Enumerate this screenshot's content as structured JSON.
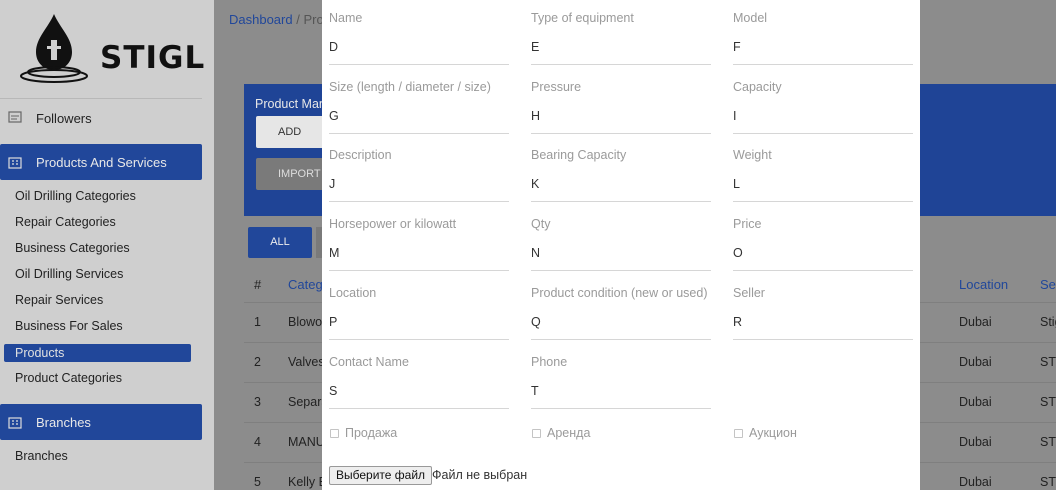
{
  "app": {
    "logo_text": "STIGL"
  },
  "sidebar": {
    "followers_label": "Followers",
    "products_services_label": "Products And Services",
    "sub_items": [
      "Oil Drilling Categories",
      "Repair Categories",
      "Business Categories",
      "Oil Drilling Services",
      "Repair Services",
      "Business For Sales",
      "Products",
      "Product Categories"
    ],
    "branches_header": "Branches",
    "branches_item": "Branches"
  },
  "breadcrumb": {
    "root": "Dashboard",
    "sep": "/",
    "current": "Pro"
  },
  "panel": {
    "title": "Product Man",
    "add_label": "ADD NEW",
    "import_label": "IMPORT"
  },
  "filters": {
    "all_label": "ALL"
  },
  "table": {
    "headers": {
      "num": "#",
      "category": "Categ",
      "location": "Location",
      "seller": "Sel"
    },
    "rows": [
      {
        "num": "1",
        "category": "Blowo",
        "location": "Dubai",
        "seller": "Stig"
      },
      {
        "num": "2",
        "category": "Valves",
        "location": "Dubai",
        "seller": "STI"
      },
      {
        "num": "3",
        "category": "Separa",
        "location": "Dubai",
        "seller": "STI"
      },
      {
        "num": "4",
        "category": "MANU",
        "location": "Dubai",
        "seller": "STI"
      },
      {
        "num": "5",
        "category": "Kelly E",
        "location": "Dubai",
        "seller": "STI"
      }
    ]
  },
  "modal": {
    "fields": [
      {
        "label": "Name",
        "value": "D"
      },
      {
        "label": "Type of equipment",
        "value": "E"
      },
      {
        "label": "Model",
        "value": "F"
      },
      {
        "label": "Size (length / diameter / size)",
        "value": "G"
      },
      {
        "label": "Pressure",
        "value": "H"
      },
      {
        "label": "Capacity",
        "value": "I"
      },
      {
        "label": "Description",
        "value": "J"
      },
      {
        "label": "Bearing Capacity",
        "value": "K"
      },
      {
        "label": "Weight",
        "value": "L"
      },
      {
        "label": "Horsepower or kilowatt",
        "value": "M"
      },
      {
        "label": "Qty",
        "value": "N"
      },
      {
        "label": "Price",
        "value": "O"
      },
      {
        "label": "Location",
        "value": "P"
      },
      {
        "label": "Product condition (new or used)",
        "value": "Q"
      },
      {
        "label": "Seller",
        "value": "R"
      },
      {
        "label": "Contact Name",
        "value": "S"
      },
      {
        "label": "Phone",
        "value": "T"
      }
    ],
    "checkboxes": [
      {
        "label": "Продажа",
        "checked": false
      },
      {
        "label": "Аренда",
        "checked": false
      },
      {
        "label": "Аукцион",
        "checked": false
      }
    ],
    "file": {
      "button_label": "Выберите файл",
      "status": "Файл не выбран"
    }
  },
  "colors": {
    "brand_blue": "#21479a",
    "overlay_gray": "#8c8c8c",
    "label_gray": "#9a9a9a"
  }
}
